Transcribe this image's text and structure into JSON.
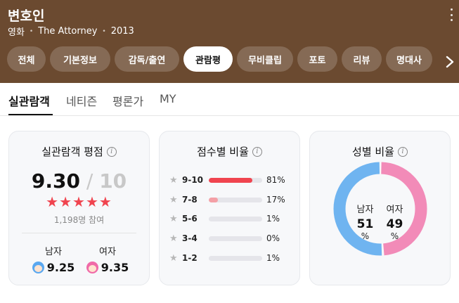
{
  "movie": {
    "title": "변호인",
    "category": "영화",
    "english_title": "The Attorney",
    "year": "2013"
  },
  "icons": {
    "more": "more-vertical-icon",
    "next": "chevron-right-icon",
    "info": "info-icon",
    "star": "star-icon",
    "male": "male-face-icon",
    "female": "female-face-icon"
  },
  "tabs": [
    {
      "label": "전체"
    },
    {
      "label": "기본정보"
    },
    {
      "label": "감독/출연"
    },
    {
      "label": "관람평",
      "active": true
    },
    {
      "label": "무비클립"
    },
    {
      "label": "포토"
    },
    {
      "label": "리뷰"
    },
    {
      "label": "명대사"
    }
  ],
  "subtabs": [
    {
      "label": "실관람객",
      "active": true
    },
    {
      "label": "네티즌"
    },
    {
      "label": "평론가"
    },
    {
      "label": "MY"
    }
  ],
  "rating_card": {
    "title": "실관람객 평점",
    "score": "9.30",
    "slash": "/",
    "max": "10",
    "stars": "★★★★★",
    "star_count": 5,
    "participants": "1,198명 참여",
    "male_label": "남자",
    "male_score": "9.25",
    "female_label": "여자",
    "female_score": "9.35"
  },
  "distribution_card": {
    "title": "점수별 비율",
    "rows": [
      {
        "range": "9-10",
        "pct_text": "81%",
        "pct": 81,
        "color": "#f0444f"
      },
      {
        "range": "7-8",
        "pct_text": "17%",
        "pct": 17,
        "color": "#f4a0a6"
      },
      {
        "range": "5-6",
        "pct_text": "1%",
        "pct": 1,
        "color": "#e5e5ea"
      },
      {
        "range": "3-4",
        "pct_text": "0%",
        "pct": 0,
        "color": "#e5e5ea"
      },
      {
        "range": "1-2",
        "pct_text": "1%",
        "pct": 1,
        "color": "#e5e5ea"
      }
    ]
  },
  "gender_card": {
    "title": "성별 비율",
    "male_label": "남자",
    "female_label": "여자",
    "male_value": "51",
    "female_value": "49",
    "male_pct": 51,
    "female_pct": 49,
    "pct_symbol": "%",
    "male_color": "#6fb4f0",
    "female_color": "#f28bb8"
  }
}
